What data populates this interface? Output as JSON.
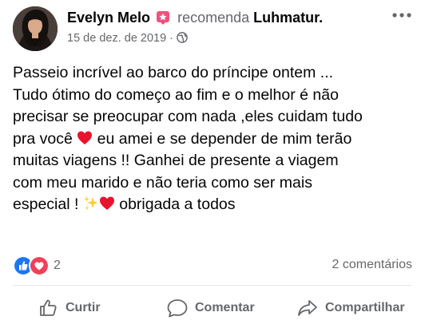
{
  "post": {
    "author": "Evelyn Melo",
    "verb": "recomenda",
    "page": "Luhmatur.",
    "date": "15 de dez. de 2019",
    "separator": "·",
    "more_label": "•••",
    "text_lines": [
      "Passeio incrível ao barco do príncipe ontem ...",
      "Tudo ótimo do começo ao fim e o melhor é não",
      "precisar se preocupar com nada ,eles cuidam tudo",
      "pra você ",
      " eu amei e se depender de mim terão",
      "muitas viagens !! Ganhei de presente a viagem",
      "com meu marido e não teria como ser mais",
      "especial ! ",
      " obrigada a todos"
    ],
    "icons": {
      "badge": "recommend-badge-icon",
      "globe": "globe-icon",
      "heart_emoji": "red-heart-emoji",
      "sparkles_emoji": "sparkles-emoji"
    }
  },
  "reactions": {
    "count": "2",
    "comments": "2 comentários",
    "like_color": "#1877f2",
    "love_color": "#f33e58"
  },
  "actions": {
    "like": "Curtir",
    "comment": "Comentar",
    "share": "Compartilhar"
  }
}
